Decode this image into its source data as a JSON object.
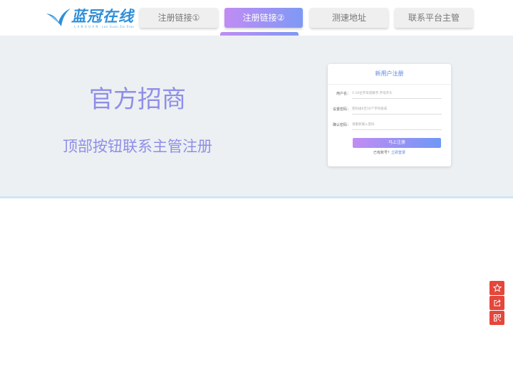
{
  "header": {
    "logo": {
      "name": "蓝冠在线",
      "subtitle": "L A N G U A N · Lan Guan Zai Xian"
    },
    "nav": [
      {
        "label": "注册链接①",
        "active": false
      },
      {
        "label": "注册链接②",
        "active": true
      },
      {
        "label": "测速地址",
        "active": false
      },
      {
        "label": "联系平台主管",
        "active": false
      }
    ]
  },
  "hero": {
    "title": "官方招商",
    "subtitle": "顶部按钮联系主管注册"
  },
  "register_form": {
    "title": "新用户注册",
    "fields": [
      {
        "label": "用户名：",
        "placeholder": "5-10位字母或数字,字母开头"
      },
      {
        "label": "设置密码：",
        "placeholder": "密码由6至16个字符组成"
      },
      {
        "label": "确认密码：",
        "placeholder": "请重新输入密码"
      }
    ],
    "submit_label": "马上注册",
    "login_prompt": "已有账号？",
    "login_link": "立即登录"
  },
  "side_tools": [
    "star-icon",
    "share-icon",
    "qrcode-icon"
  ],
  "colors": {
    "accent_start": "#c18cf3",
    "accent_end": "#7e99f5",
    "hero_text": "#8f8ee8",
    "hero_bg": "#ecf0f2",
    "side_tool_bg": "#e4473b",
    "logo_blue": "#2f8fd8"
  }
}
